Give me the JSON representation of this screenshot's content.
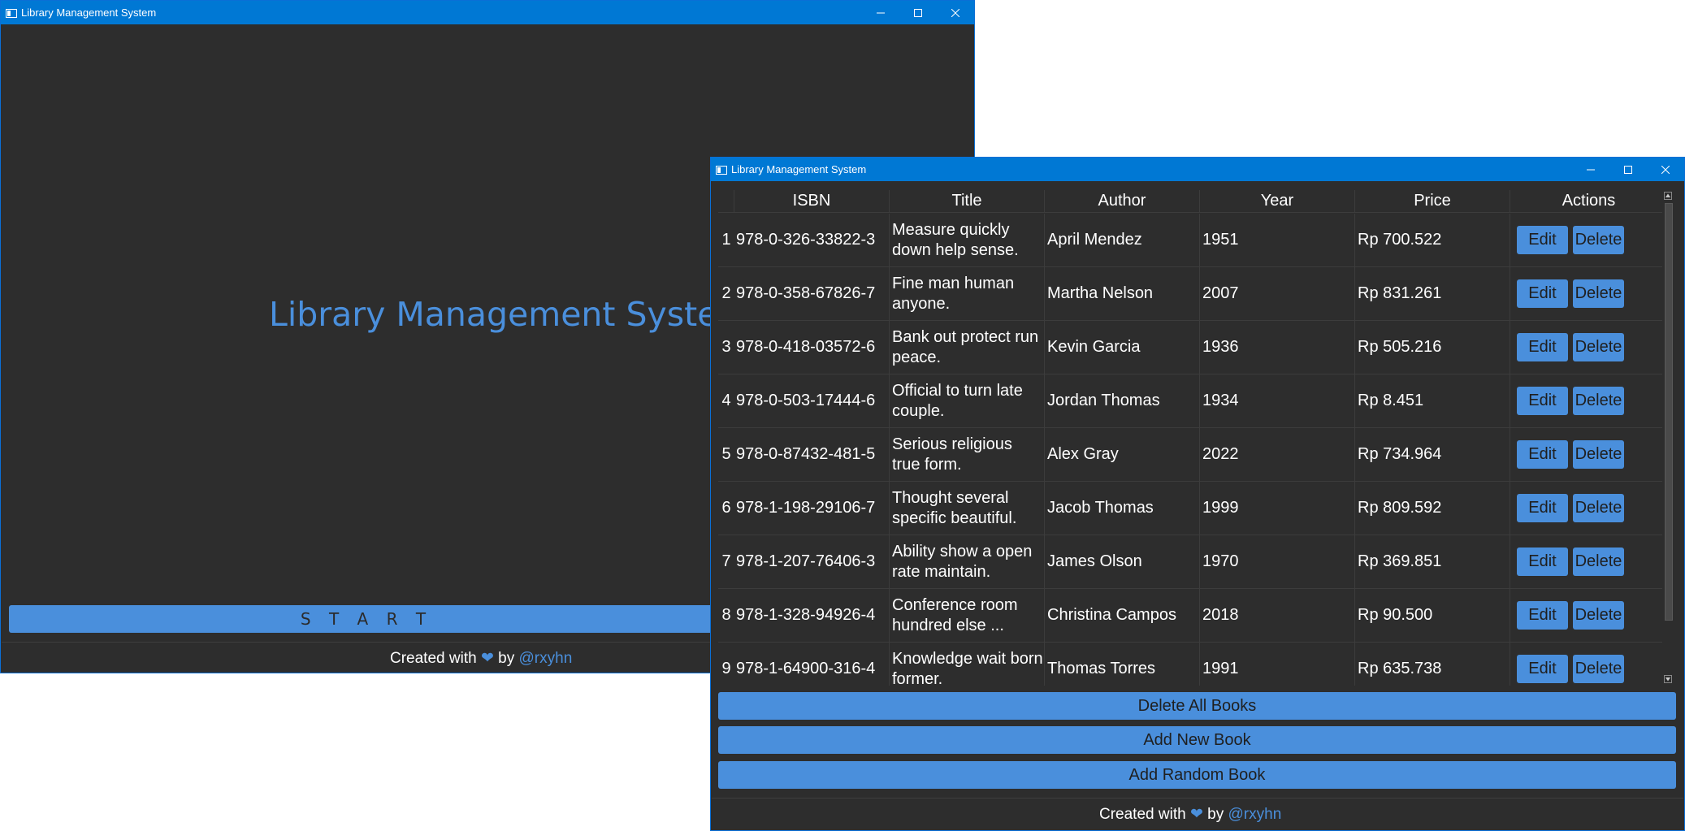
{
  "window_main": {
    "title": "Library Management System",
    "hero_title": "Library Management System",
    "start_label": "S T A R T",
    "footer": {
      "prefix": "Created with",
      "heart": "❤",
      "by": "by",
      "handle": "@rxyhn"
    }
  },
  "window_books": {
    "title": "Library Management System",
    "columns": [
      "ISBN",
      "Title",
      "Author",
      "Year",
      "Price",
      "Actions"
    ],
    "rows": [
      {
        "num": "1",
        "isbn": "978-0-326-33822-3",
        "title": "Measure quickly down help sense.",
        "author": "April Mendez",
        "year": "1951",
        "price": "Rp 700.522"
      },
      {
        "num": "2",
        "isbn": "978-0-358-67826-7",
        "title": "Fine man human anyone.",
        "author": "Martha Nelson",
        "year": "2007",
        "price": "Rp 831.261"
      },
      {
        "num": "3",
        "isbn": "978-0-418-03572-6",
        "title": "Bank out protect run peace.",
        "author": "Kevin Garcia",
        "year": "1936",
        "price": "Rp 505.216"
      },
      {
        "num": "4",
        "isbn": "978-0-503-17444-6",
        "title": "Official to turn late couple.",
        "author": "Jordan Thomas",
        "year": "1934",
        "price": "Rp 8.451"
      },
      {
        "num": "5",
        "isbn": "978-0-87432-481-5",
        "title": "Serious religious true form.",
        "author": "Alex Gray",
        "year": "2022",
        "price": "Rp 734.964"
      },
      {
        "num": "6",
        "isbn": "978-1-198-29106-7",
        "title": "Thought several specific beautiful.",
        "author": "Jacob Thomas",
        "year": "1999",
        "price": "Rp 809.592"
      },
      {
        "num": "7",
        "isbn": "978-1-207-76406-3",
        "title": "Ability show a open rate maintain.",
        "author": "James Olson",
        "year": "1970",
        "price": "Rp 369.851"
      },
      {
        "num": "8",
        "isbn": "978-1-328-94926-4",
        "title": "Conference room hundred else ...",
        "author": "Christina Campos",
        "year": "2018",
        "price": "Rp 90.500"
      },
      {
        "num": "9",
        "isbn": "978-1-64900-316-4",
        "title": "Knowledge wait born former.",
        "author": "Thomas Torres",
        "year": "1991",
        "price": "Rp 635.738"
      }
    ],
    "edit_label": "Edit",
    "delete_label": "Delete",
    "delete_all_label": "Delete All Books",
    "add_new_label": "Add New Book",
    "add_random_label": "Add Random Book",
    "footer": {
      "prefix": "Created with",
      "heart": "❤",
      "by": "by",
      "handle": "@rxyhn"
    }
  },
  "colors": {
    "accent": "#4a8fdc",
    "titlebar": "#0078d4",
    "background": "#2d2d2d"
  }
}
